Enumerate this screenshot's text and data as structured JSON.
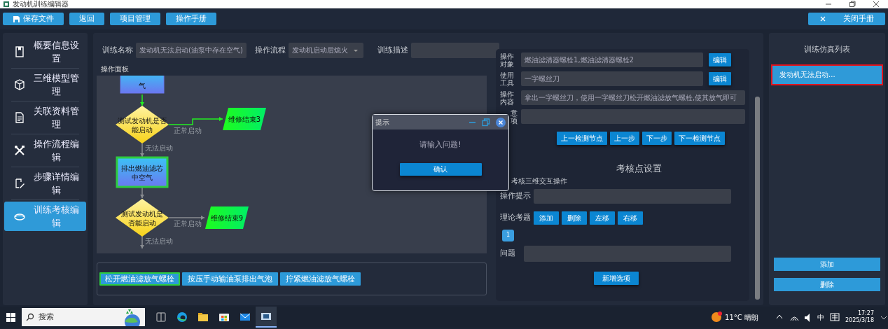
{
  "window": {
    "title": "发动机训练编辑器"
  },
  "toolbar": {
    "buttons": [
      {
        "label": "保存文件",
        "kind": "save"
      },
      {
        "label": "返回",
        "kind": "plain"
      },
      {
        "label": "项目管理",
        "kind": "plain"
      },
      {
        "label": "操作手册",
        "kind": "plain"
      }
    ],
    "close_manual": {
      "label": "关闭手册"
    }
  },
  "sidebar": {
    "items": [
      {
        "label": "概要信息设置",
        "kind": "summary",
        "selected": false
      },
      {
        "label": "三维模型管理",
        "kind": "cube",
        "selected": false
      },
      {
        "label": "关联资料管理",
        "kind": "doc",
        "selected": false
      },
      {
        "label": "操作流程编辑",
        "kind": "tools",
        "selected": false
      },
      {
        "label": "步骤详情编辑",
        "kind": "edit",
        "selected": false
      },
      {
        "label": "训练考核编辑",
        "kind": "exam",
        "selected": true
      }
    ]
  },
  "header_form": {
    "name_label": "训练名称",
    "name_value": "发动机无法启动(油泵中存在空气)",
    "flow_label": "操作流程",
    "flow_value": "发动机启动后熄火",
    "desc_label": "训练描述"
  },
  "flow_panel": {
    "title": "操作面板",
    "nodes": [
      {
        "kind": "process",
        "lines": [
          "气"
        ],
        "selected": false
      },
      {
        "kind": "decision",
        "lines": [
          "测试发动机是否",
          "能启动"
        ],
        "selected": false
      },
      {
        "kind": "terminal",
        "lines": [
          "维修结束3"
        ],
        "selected": false
      },
      {
        "kind": "process",
        "lines": [
          "排出燃油滤芯",
          "中空气"
        ],
        "selected": true
      },
      {
        "kind": "decision",
        "lines": [
          "测试发动机是",
          "否能启动"
        ],
        "selected": false
      },
      {
        "kind": "terminal",
        "lines": [
          "维修结束9"
        ],
        "selected": false
      }
    ],
    "edges": [
      {
        "active": true
      },
      {
        "label": "正常启动",
        "active": true
      },
      {
        "label": "无法启动",
        "active": false
      },
      {
        "active": false
      },
      {
        "label": "正常启动",
        "active": false
      },
      {
        "label": "无法启动",
        "active": false
      }
    ]
  },
  "step_buttons": [
    {
      "label": "松开燃油滤放气螺栓",
      "selected": true
    },
    {
      "label": "按压手动输油泵排出气泡",
      "selected": false
    },
    {
      "label": "拧紧燃油滤放气螺栓",
      "selected": false
    }
  ],
  "details": {
    "fields": [
      {
        "label": "操作对象",
        "value": "燃油滤清器螺栓1,燃油滤清器螺栓2",
        "button": "编辑"
      },
      {
        "label": "使用工具",
        "value": "一字螺丝刀",
        "button": "编辑"
      },
      {
        "label": "操作内容",
        "value": "拿出一字螺丝刀，使用一字螺丝刀松开燃油滤放气螺栓,使其放气即可"
      },
      {
        "label": "意项"
      }
    ],
    "nav_buttons": [
      "上一检测节点",
      "上一步",
      "下一步",
      "下一检测节点"
    ],
    "section_title": "考核点设置",
    "interaction_label": "考核三维交互操作",
    "hint_label": "操作提示",
    "theory_label": "理论考题",
    "theory_buttons": [
      "添加",
      "删除",
      "左移",
      "右移"
    ],
    "pages": [
      {
        "label": "1",
        "selected": true
      }
    ],
    "question_label": "问题",
    "add_option": "新增选项"
  },
  "sim_list": {
    "title": "训练仿真列表",
    "items": [
      {
        "label": "发动机无法启动...",
        "selected": true
      }
    ],
    "buttons": [
      "添加",
      "删除"
    ]
  },
  "dialog": {
    "title": "提示",
    "message": "请输入问题!",
    "button": "确认"
  },
  "taskbar": {
    "search_placeholder": "搜索",
    "weather": "11°C 晴朗",
    "ime": "中",
    "time": "17:27",
    "date": "2025/3/18"
  }
}
